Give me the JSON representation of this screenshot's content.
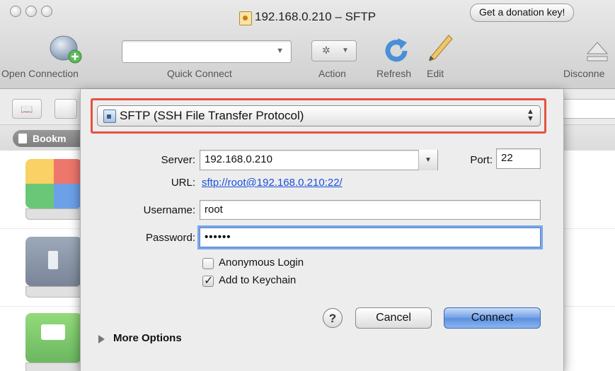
{
  "window": {
    "title": "192.168.0.210 – SFTP",
    "donation_button": "Get a donation key!"
  },
  "toolbar": {
    "open_connection": "Open Connection",
    "quick_connect": "Quick Connect",
    "action": "Action",
    "refresh": "Refresh",
    "edit": "Edit",
    "disconnect": "Disconne"
  },
  "sidebar": {
    "bookmarks_tab": "Bookm"
  },
  "sheet": {
    "protocol": "SFTP (SSH File Transfer Protocol)",
    "server_label": "Server:",
    "server_value": "192.168.0.210",
    "port_label": "Port:",
    "port_value": "22",
    "url_label": "URL:",
    "url_value": "sftp://root@192.168.0.210:22/",
    "username_label": "Username:",
    "username_value": "root",
    "password_label": "Password:",
    "password_value": "••••••",
    "anonymous_label": "Anonymous Login",
    "anonymous_checked": false,
    "keychain_label": "Add to Keychain",
    "keychain_checked": true,
    "help_label": "?",
    "cancel_label": "Cancel",
    "connect_label": "Connect",
    "more_options_label": "More Options"
  },
  "colors": {
    "highlight": "#e65140",
    "link": "#1a4fe0",
    "connect_button": "#6f9fe6"
  }
}
